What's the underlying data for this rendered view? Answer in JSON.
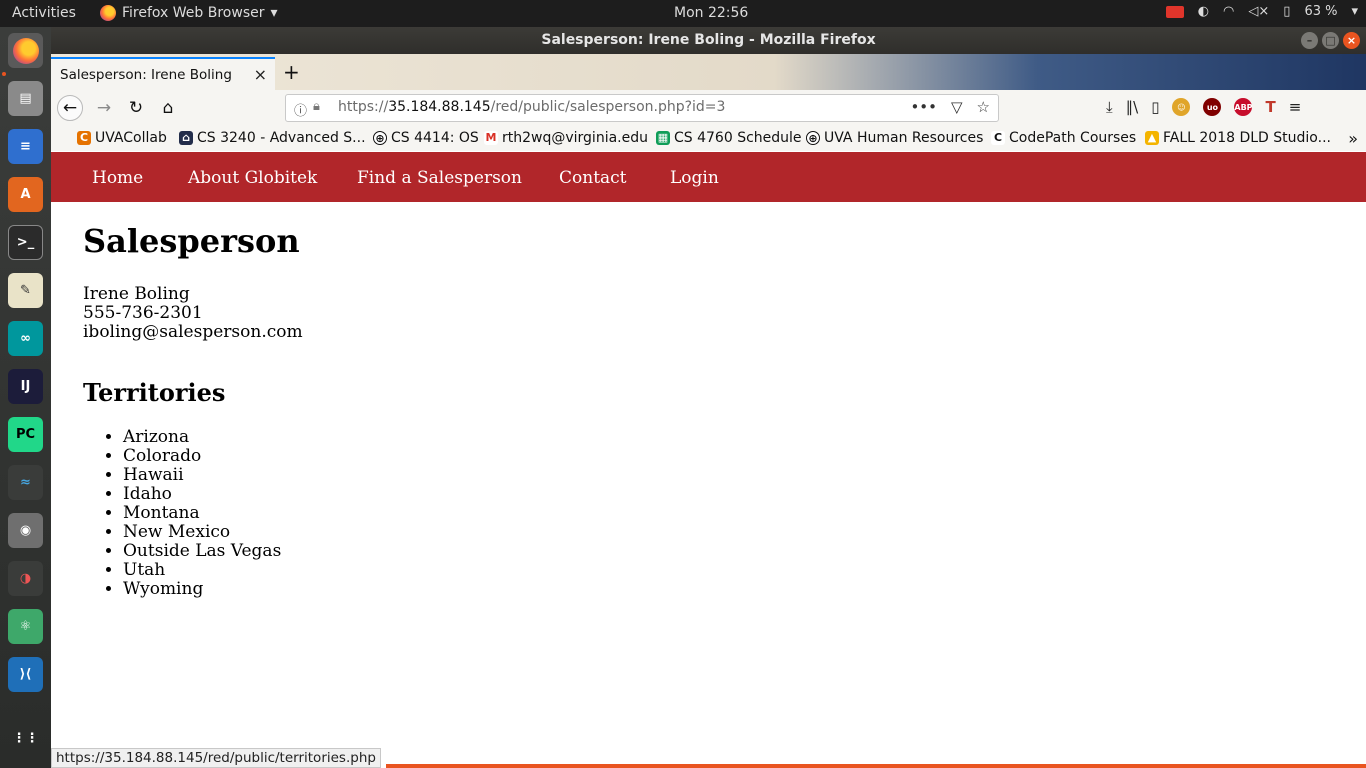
{
  "system": {
    "activities": "Activities",
    "app_name": "Firefox Web Browser",
    "clock": "Mon 22:56",
    "battery": "63 %"
  },
  "window": {
    "title": "Salesperson: Irene Boling - Mozilla Firefox"
  },
  "browser": {
    "tab_title": "Salesperson: Irene Boling",
    "url_scheme": "https://",
    "url_host": "35.184.88.145",
    "url_path": "/red/public/salesperson.php?id=3",
    "bookmarks": [
      "UVACollab",
      "CS 3240 - Advanced S...",
      "CS 4414: OS",
      "rth2wq@virginia.edu",
      "CS 4760 Schedule",
      "UVA Human Resources",
      "CodePath Courses",
      "FALL 2018 DLD Studio..."
    ],
    "status_url": "https://35.184.88.145/red/public/territories.php"
  },
  "site": {
    "nav": [
      "Home",
      "About Globitek",
      "Find a Salesperson",
      "Contact",
      "Login"
    ],
    "page_title": "Salesperson",
    "salesperson": {
      "name": "Irene Boling",
      "phone": "555-736-2301",
      "email": "iboling@salesperson.com"
    },
    "territories_heading": "Territories",
    "territories": [
      "Arizona",
      "Colorado",
      "Hawaii",
      "Idaho",
      "Montana",
      "New Mexico",
      "Outside Las Vegas",
      "Utah",
      "Wyoming"
    ]
  },
  "colors": {
    "site_nav_bg": "#b1262a",
    "ubuntu_accent": "#e95420",
    "tab_indicator": "#0a84ff"
  }
}
